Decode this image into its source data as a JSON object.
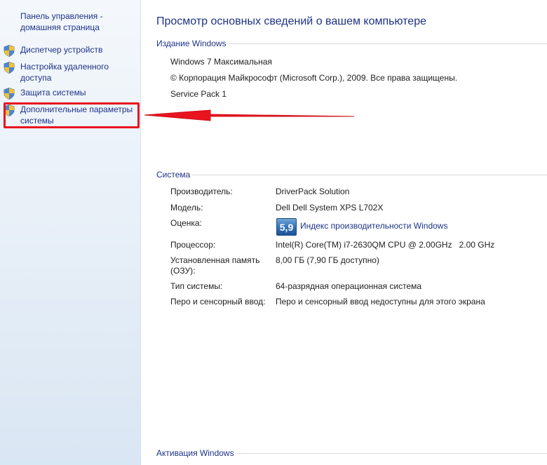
{
  "sidebar": {
    "home_link": "Панель управления - домашняя страница",
    "items": [
      {
        "label": "Диспетчер устройств",
        "icon": "uac-shield-icon"
      },
      {
        "label": "Настройка удаленного доступа",
        "icon": "uac-shield-icon"
      },
      {
        "label": "Защита системы",
        "icon": "uac-shield-icon"
      },
      {
        "label": "Дополнительные параметры системы",
        "icon": "uac-shield-icon"
      }
    ]
  },
  "main": {
    "title": "Просмотр основных сведений о вашем компьютере",
    "edition": {
      "header": "Издание Windows",
      "name": "Windows 7 Максимальная",
      "copyright": "© Корпорация Майкрософт (Microsoft Corp.), 2009. Все права защищены.",
      "service_pack": "Service Pack 1"
    },
    "system": {
      "header": "Система",
      "rows": [
        {
          "label": "Производитель:",
          "value": "DriverPack Solution"
        },
        {
          "label": "Модель:",
          "value": "Dell Dell System XPS L702X"
        },
        {
          "label": "Оценка:",
          "score": "5,9",
          "link": "Индекс производительности Windows"
        },
        {
          "label": "Процессор:",
          "value": "Intel(R) Core(TM) i7-2630QM CPU @ 2.00GHz   2.00 GHz"
        },
        {
          "label": "Установленная память (ОЗУ):",
          "value": "8,00 ГБ (7,90 ГБ доступно)"
        },
        {
          "label": "Тип системы:",
          "value": "64-разрядная операционная система"
        },
        {
          "label": "Перо и сенсорный ввод:",
          "value": "Перо и сенсорный ввод недоступны для этого экрана"
        }
      ]
    },
    "activation": {
      "header": "Активация Windows"
    }
  },
  "colors": {
    "link": "#1e3287",
    "highlight": "#e8141e",
    "arrow": "#e8141e",
    "sidebar_bg": "#e9f0f8"
  }
}
